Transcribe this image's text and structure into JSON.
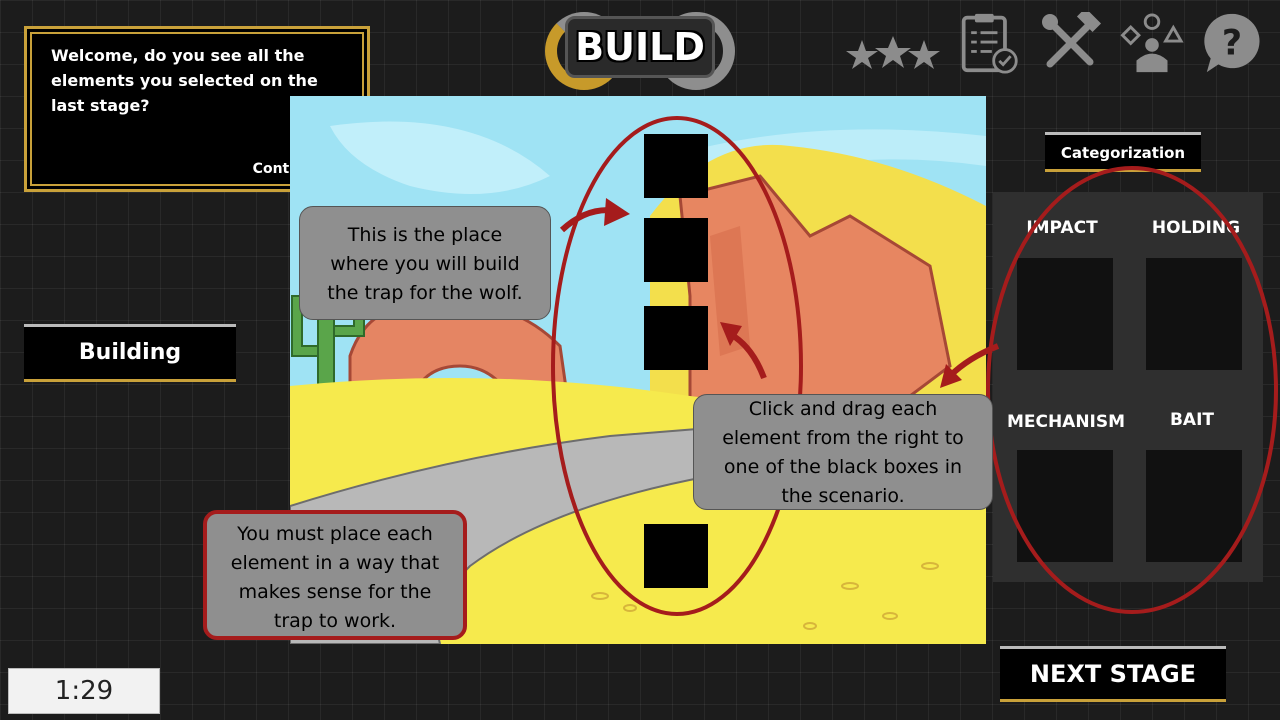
{
  "dialog": {
    "text": "Welcome, do you see all the elements you selected on the last stage?",
    "continue": "Continue››"
  },
  "header": {
    "title": "BUILD",
    "icons": [
      "stars-icon",
      "checklist-icon",
      "tools-icon",
      "shapes-user-icon",
      "help-icon"
    ]
  },
  "left": {
    "building_label": "Building"
  },
  "categorization": {
    "title": "Categorization",
    "categories": [
      "IMPACT",
      "HOLDING",
      "MECHANISM",
      "BAIT"
    ]
  },
  "callouts": {
    "build_place": "This is the place where you will build the trap for the wolf.",
    "drag": "Click and drag each element from the right to one of the black boxes in the scenario.",
    "place": "You must place each element in a way that makes sense for the trap to work."
  },
  "next_stage": "NEXT STAGE",
  "timer": "1:29",
  "colors": {
    "accent_gold": "#c9a13a",
    "annotation_red": "#a51c1c",
    "callout_gray": "#8f8f8f"
  }
}
